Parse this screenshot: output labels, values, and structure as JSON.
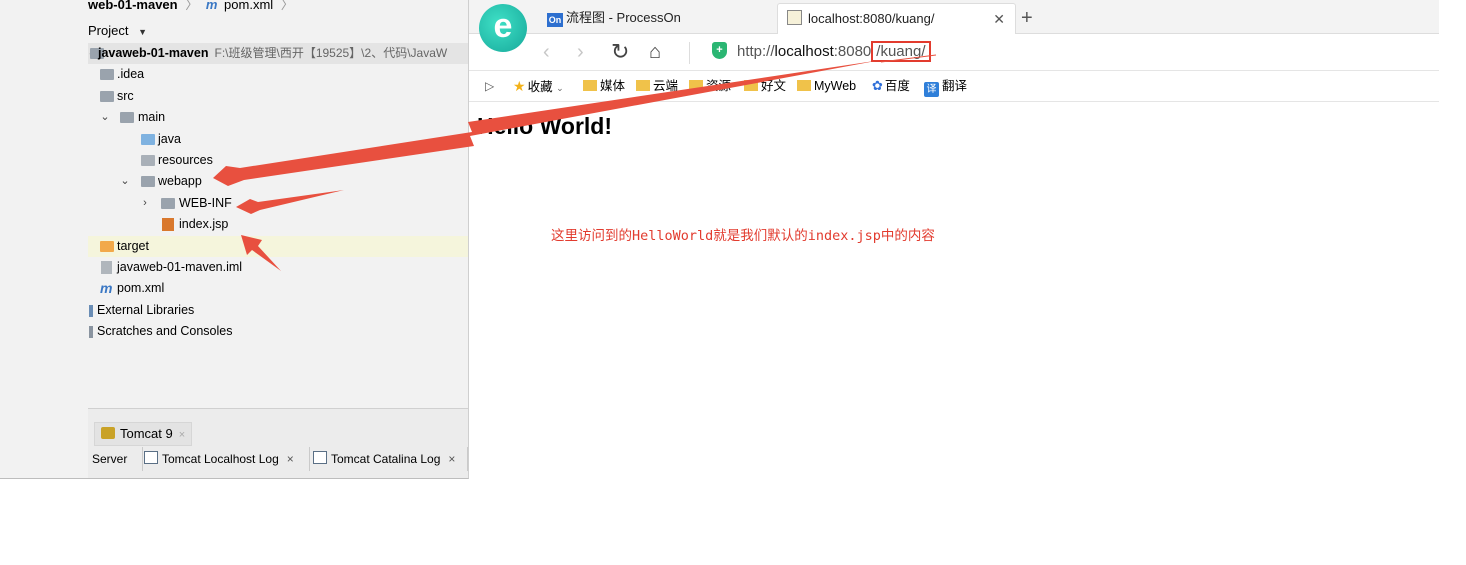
{
  "ide": {
    "breadcrumb": {
      "module": "web-01-maven",
      "file": "pom.xml"
    },
    "project_label": "Project",
    "tree": {
      "root_name": "javaweb-01-maven",
      "root_path": "F:\\班级管理\\西开【19525】\\2、代码\\JavaW",
      "items": {
        "idea": ".idea",
        "src": "src",
        "main": "main",
        "java": "java",
        "resources": "resources",
        "webapp": "webapp",
        "webinf": "WEB-INF",
        "index": "index.jsp",
        "target": "target",
        "iml": "javaweb-01-maven.iml",
        "pom": "pom.xml",
        "external": "External Libraries",
        "scratches": "Scratches and Consoles"
      }
    },
    "bottom": {
      "tomcat_tab": "Tomcat 9",
      "server": "Server",
      "localhost_log": "Tomcat Localhost Log",
      "catalina_log": "Tomcat Catalina Log"
    }
  },
  "browser": {
    "tabs": [
      {
        "label": "流程图 - ProcessOn",
        "icon": "On"
      },
      {
        "label": "localhost:8080/kuang/"
      }
    ],
    "url": {
      "scheme": "http://",
      "host": "localhost",
      "port": ":8080",
      "path": "/kuang/"
    },
    "bookmarks": [
      "收藏",
      "媒体",
      "云端",
      "资源",
      "好文",
      "MyWeb",
      "百度",
      "翻译"
    ],
    "page_heading": "Hello World!"
  },
  "annotation": {
    "note": "这里访问到的HelloWorld就是我们默认的index.jsp中的内容",
    "color": "#e23b2e"
  }
}
